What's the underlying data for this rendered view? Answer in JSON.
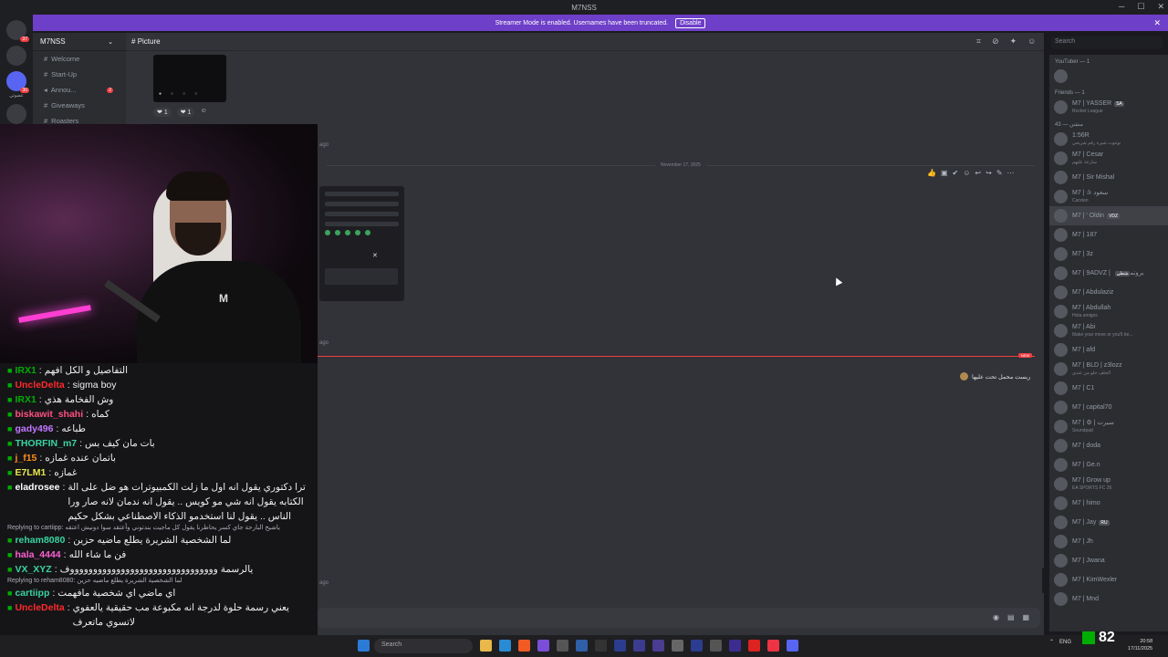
{
  "window": {
    "title": "M7NSS"
  },
  "banner": {
    "text": "Streamer Mode is enabled. Usernames have been truncated.",
    "button": "Disable"
  },
  "guilds": {
    "label": "عضوتي",
    "badges": [
      "37",
      "30"
    ]
  },
  "server": {
    "name": "M7NSS"
  },
  "channels": [
    {
      "label": "Welcome",
      "badge": ""
    },
    {
      "label": "Start-Up",
      "badge": ""
    },
    {
      "label": "Annou...",
      "badge": "2"
    },
    {
      "label": "Giveaways",
      "badge": ""
    },
    {
      "label": "Roasters",
      "badge": ""
    }
  ],
  "header": {
    "channel": "Picture"
  },
  "search": {
    "placeholder": "Search"
  },
  "messages": {
    "reactions": [
      "1",
      "1"
    ],
    "time_ago_1": "ago",
    "date_divider": "November 17, 2025",
    "time_ago_2": "ago",
    "time_ago_3": "ago",
    "new_badge": "NEW",
    "arabic_message": "ربست محمل تحت عليها"
  },
  "members": {
    "groups": [
      {
        "title": "YouTuber — 1",
        "items": [
          {
            "name": "",
            "sub": ""
          }
        ]
      },
      {
        "title": "Friends — 1",
        "items": [
          {
            "name": "M7 | YASSER",
            "sub": "Rocket League",
            "tag": "SA"
          }
        ]
      },
      {
        "title": "43 — منشن",
        "items": [
          {
            "name": "1:56R",
            "sub": "نوتنوت شيرة رقم شريحي"
          },
          {
            "name": "M7 | Cesar",
            "sub": "سارعة عليهم"
          },
          {
            "name": "M7 | Sir Mishal",
            "sub": ""
          },
          {
            "name": "M7 | ✰ سعود",
            "sub": "Carsten"
          },
          {
            "name": "M7 | ' Oldin",
            "sub": "",
            "tag": "VDZ"
          },
          {
            "name": "M7 | 187",
            "sub": ""
          },
          {
            "name": "M7 | 3z",
            "sub": ""
          },
          {
            "name": "M7 | 9ADVZ | بروتم",
            "sub": "",
            "tag": "شطي"
          },
          {
            "name": "M7 | Abdulaziz",
            "sub": ""
          },
          {
            "name": "M7 | Abdullah",
            "sub": "Hola amigos"
          },
          {
            "name": "M7 | Abi",
            "sub": "Make your move or you'll be..."
          },
          {
            "name": "M7 | afd",
            "sub": ""
          },
          {
            "name": "M7 | BLD | z3lozz",
            "sub": "الحلف حلو من عندي"
          },
          {
            "name": "M7 | C1",
            "sub": ""
          },
          {
            "name": "M7 | capital70",
            "sub": ""
          },
          {
            "name": "M7 | ⚙ | سيرت",
            "sub": "Soundpad"
          },
          {
            "name": "M7 | doda",
            "sub": ""
          },
          {
            "name": "M7 | Ge.n",
            "sub": ""
          },
          {
            "name": "M7 | Grow up",
            "sub": "EA SPORTS FC 26"
          },
          {
            "name": "M7 | himo",
            "sub": ""
          },
          {
            "name": "M7 | Jay",
            "sub": "",
            "tag": "RU"
          },
          {
            "name": "M7 | Jh",
            "sub": ""
          },
          {
            "name": "M7 | Jwana",
            "sub": ""
          },
          {
            "name": "M7 | KimWexler",
            "sub": ""
          },
          {
            "name": "M7 | Mnd",
            "sub": ""
          }
        ]
      }
    ]
  },
  "chat": [
    {
      "user": "IRX1",
      "color": "#00ad03",
      "text": "التفاصيل و الكل افهم"
    },
    {
      "user": "UncleDelta",
      "color": "#ff2a2a",
      "text": "sigma boy"
    },
    {
      "user": "IRX1",
      "color": "#00ad03",
      "text": "وش الفخامة هذي"
    },
    {
      "user": "biskawit_shahi",
      "color": "#ff4f7f",
      "text": "كماه"
    },
    {
      "user": "gady496",
      "color": "#c277ff",
      "text": "طباعه"
    },
    {
      "user": "THORFIN_m7",
      "color": "#3ad3a1",
      "text": "بات مان كيف بس"
    },
    {
      "user": "j_f15",
      "color": "#ff8c1a",
      "text": "باتمان عنده غمازه"
    },
    {
      "user": "E7LM1",
      "color": "#e6e64a",
      "text": "غمازه"
    },
    {
      "user": "eladrosee",
      "color": "#ffffff",
      "text": "ترا دكتوري يقول انه اول ما زلت الكمبيوترات هو ضل على الة الكتابه يقول انه شي مو كويس .. يقول انه ندمان لانه صار ورا الناس .. يقول لنا استخدمو الذكاء الاصطناعي بشكل حكيم"
    },
    {
      "reply": "Replying to cartiipp: ياشيخ البارحة جاي كسر يحاطرنا يقول كل ماجيت بندتوني وأعتقد سوا دونيش اعتقه"
    },
    {
      "user": "reham8080",
      "color": "#3ad3a1",
      "text": "لما الشخصية الشريرة يطلع ماضيه حزين"
    },
    {
      "user": "hala_4444",
      "color": "#ff5fd2",
      "text": "فن ما شاء الله"
    },
    {
      "user": "VX_XYZ",
      "color": "#3ad3a1",
      "text": "يالرسمة ووووووووووووووووووووووووووووووووف"
    },
    {
      "reply": "Replying to reham8080: لما الشخصية الشريرة يطلع ماضيه حزين"
    },
    {
      "user": "cartiipp",
      "color": "#3ad3a1",
      "text": "اي ماضي اي شخصية مافهمت"
    },
    {
      "user": "UncleDelta",
      "color": "#ff2a2a",
      "text": "يعني رسمة حلوة لدرجة انه مكبوعة مب حقيقية يالعفوي لاتسوي ماتعرف"
    }
  ],
  "taskbar": {
    "search": "Search",
    "lang": "ENG",
    "time": "20:58",
    "date": "17/11/2025"
  },
  "viewer_count": "82"
}
